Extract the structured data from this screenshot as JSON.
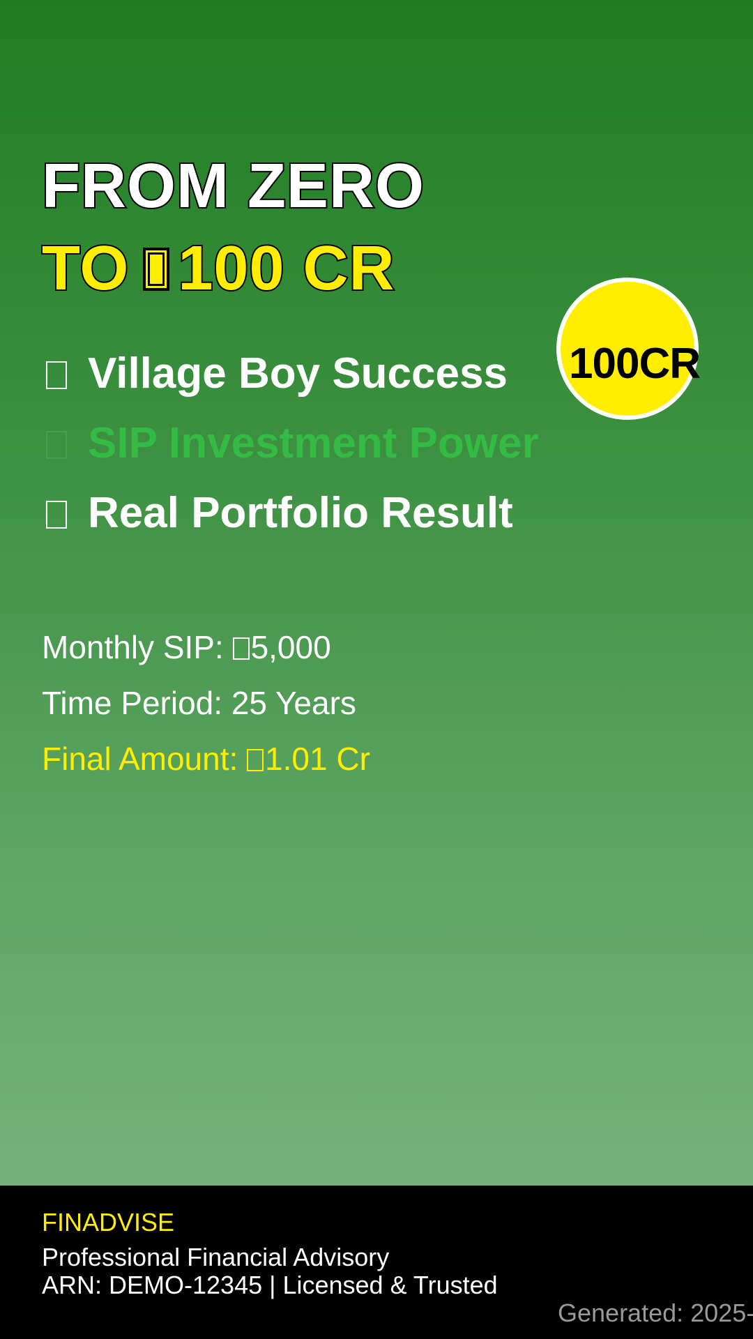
{
  "headline": {
    "line1": "FROM ZERO",
    "line2_prefix": "TO",
    "line2_suffix": "100 CR"
  },
  "badge": {
    "label": "100CR"
  },
  "points": [
    {
      "label": "Village Boy Success"
    },
    {
      "label": "SIP Investment Power"
    },
    {
      "label": "Real Portfolio Result"
    }
  ],
  "stats": {
    "monthly_sip_label": "Monthly SIP:",
    "monthly_sip_value": "5,000",
    "time_period": "Time Period: 25 Years",
    "final_amount_label": "Final Amount:",
    "final_amount_value": "1.01 Cr"
  },
  "footer": {
    "brand": "FINADVISE",
    "tagline": "Professional Financial Advisory",
    "arn": "ARN: DEMO-12345 | Licensed & Trusted",
    "generated": "Generated: 2025-"
  },
  "colors": {
    "accent_yellow": "#ffee00",
    "dim_green": "#33bb44",
    "footer_bg": "#000000"
  },
  "icons": {
    "rupee": "missing-glyph-box",
    "bullet": "missing-glyph-box"
  }
}
